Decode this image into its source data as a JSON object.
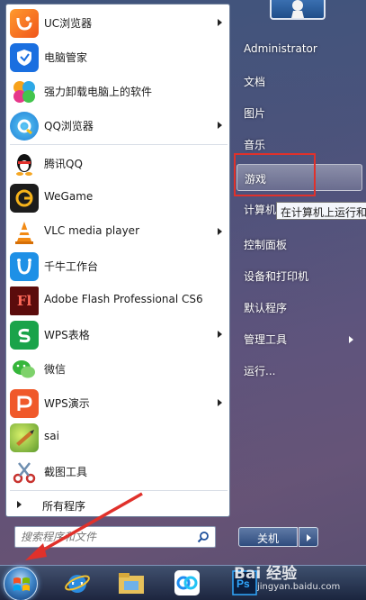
{
  "start_menu": {
    "programs": [
      {
        "label": "UC浏览器",
        "icon": "uc-browser-icon",
        "has_submenu": true
      },
      {
        "label": "电脑管家",
        "icon": "pc-manager-icon",
        "has_submenu": false
      },
      {
        "label": "强力卸载电脑上的软件",
        "icon": "uninstaller-icon",
        "has_submenu": false
      },
      {
        "label": "QQ浏览器",
        "icon": "qq-browser-icon",
        "has_submenu": true
      },
      {
        "label": "腾讯QQ",
        "icon": "qq-penguin-icon",
        "has_submenu": false
      },
      {
        "label": "WeGame",
        "icon": "wegame-icon",
        "has_submenu": false
      },
      {
        "label": "VLC media player",
        "icon": "vlc-cone-icon",
        "has_submenu": true
      },
      {
        "label": "千牛工作台",
        "icon": "qianniu-icon",
        "has_submenu": false
      },
      {
        "label": "Adobe Flash Professional CS6",
        "icon": "flash-icon",
        "has_submenu": false
      },
      {
        "label": "WPS表格",
        "icon": "wps-spreadsheet-icon",
        "has_submenu": true
      },
      {
        "label": "微信",
        "icon": "wechat-icon",
        "has_submenu": false
      },
      {
        "label": "WPS演示",
        "icon": "wps-presentation-icon",
        "has_submenu": true
      },
      {
        "label": "sai",
        "icon": "sai-icon",
        "has_submenu": false
      },
      {
        "label": "截图工具",
        "icon": "snipping-tool-icon",
        "has_submenu": false
      }
    ],
    "all_programs": "所有程序",
    "search_placeholder": "搜索程序和文件",
    "right_items": [
      {
        "label": "Administrator",
        "has_submenu": false
      },
      {
        "label": "文档",
        "has_submenu": false
      },
      {
        "label": "图片",
        "has_submenu": false
      },
      {
        "label": "音乐",
        "has_submenu": false
      },
      {
        "label": "游戏",
        "has_submenu": false,
        "highlighted": true
      },
      {
        "label": "计算机",
        "has_submenu": false
      },
      {
        "label": "控制面板",
        "has_submenu": false
      },
      {
        "label": "设备和打印机",
        "has_submenu": false
      },
      {
        "label": "默认程序",
        "has_submenu": false
      },
      {
        "label": "管理工具",
        "has_submenu": true
      },
      {
        "label": "运行...",
        "has_submenu": false
      }
    ],
    "tooltip": "在计算机上运行和",
    "shutdown_label": "关机"
  },
  "taskbar": {
    "items": [
      "start-orb-icon",
      "internet-explorer-icon",
      "file-explorer-icon",
      "baidu-netdisk-icon",
      "photoshop-icon"
    ]
  },
  "watermark": {
    "text": "Bai 经验",
    "sub": "jingyan.baidu.com"
  },
  "colors": {
    "highlight_box": "#e0312b",
    "annotation_arrow": "#e0312b"
  }
}
